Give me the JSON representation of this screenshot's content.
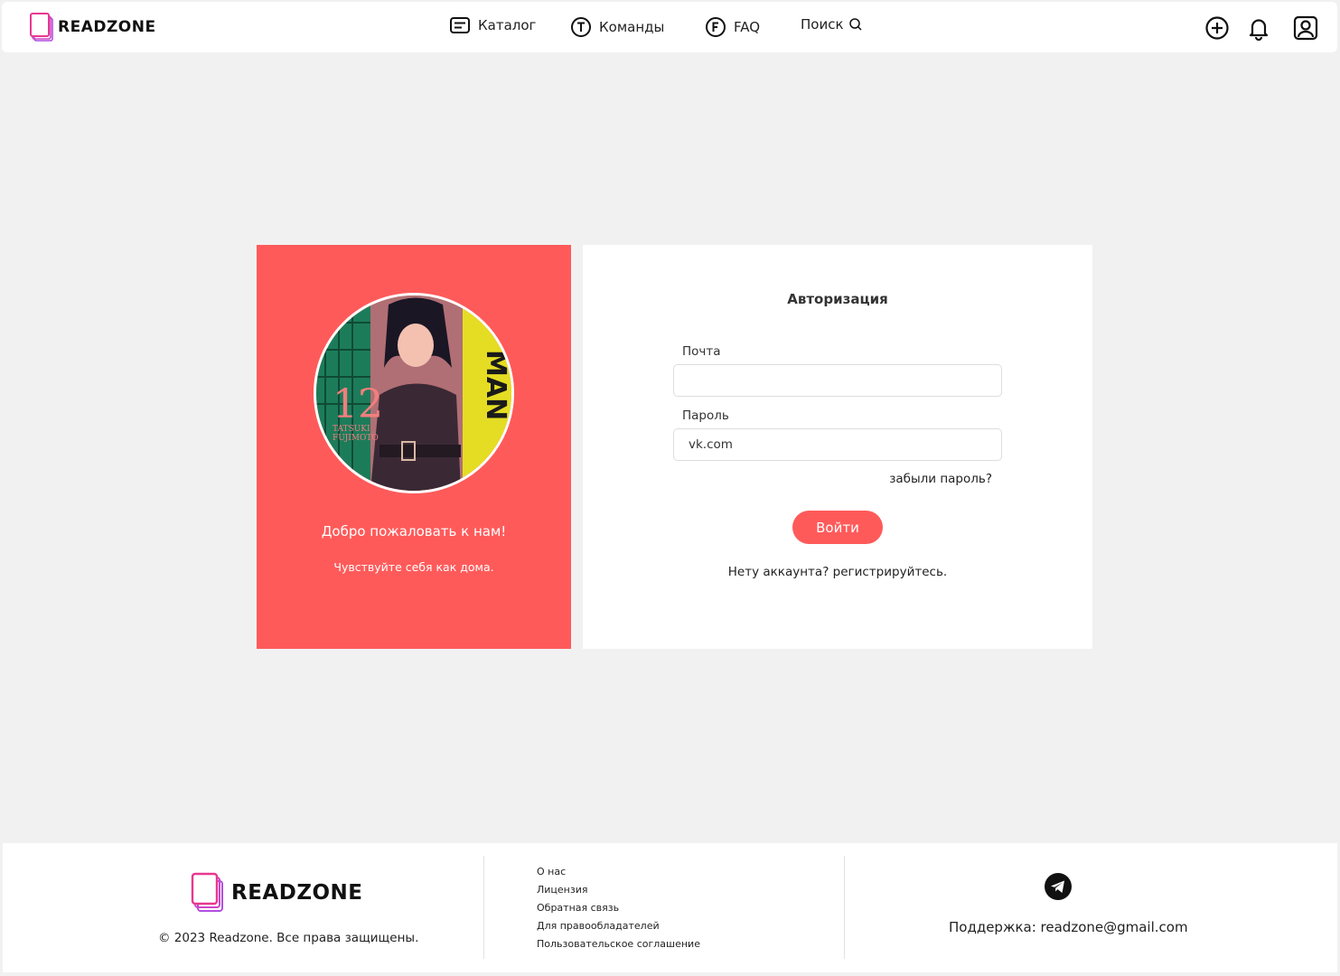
{
  "header": {
    "brand": "READZONE",
    "nav": {
      "catalog": "Каталог",
      "teams": "Команды",
      "faq": "FAQ",
      "search": "Поиск"
    }
  },
  "welcome": {
    "title": "Добро пожаловать к нам!",
    "subtitle": "Чувствуйте себя как дома."
  },
  "auth": {
    "title": "Авторизация",
    "email_label": "Почта",
    "email_value": "",
    "password_label": "Пароль",
    "password_value": "vk.com",
    "forgot": "забыли пароль?",
    "login_button": "Войти",
    "register": "Нету аккаунта? регистрируйтесь."
  },
  "avatar_text": {
    "volume": "12",
    "author_line1": "TATSUKI",
    "author_line2": "FUJIMOTO",
    "spine": "MAN"
  },
  "footer": {
    "brand": "READZONE",
    "copyright": "© 2023 Readzone. Все права защищены.",
    "links": [
      "О нас",
      "Лицензия",
      "Обратная связь",
      "Для правообладателей",
      "Пользовательское соглашение"
    ],
    "support": "Поддержка: readzone@gmail.com"
  },
  "colors": {
    "accent": "#ff5a5a",
    "logo_pink": "#e8388f",
    "logo_purple": "#b14fe0",
    "background": "#f1f1f1"
  },
  "icons": {
    "catalog": "list-icon",
    "teams": "t-circle-icon",
    "faq": "f-circle-icon",
    "search": "search-icon",
    "add": "plus-circle-icon",
    "notifications": "bell-icon",
    "profile": "user-icon",
    "telegram": "telegram-icon"
  }
}
